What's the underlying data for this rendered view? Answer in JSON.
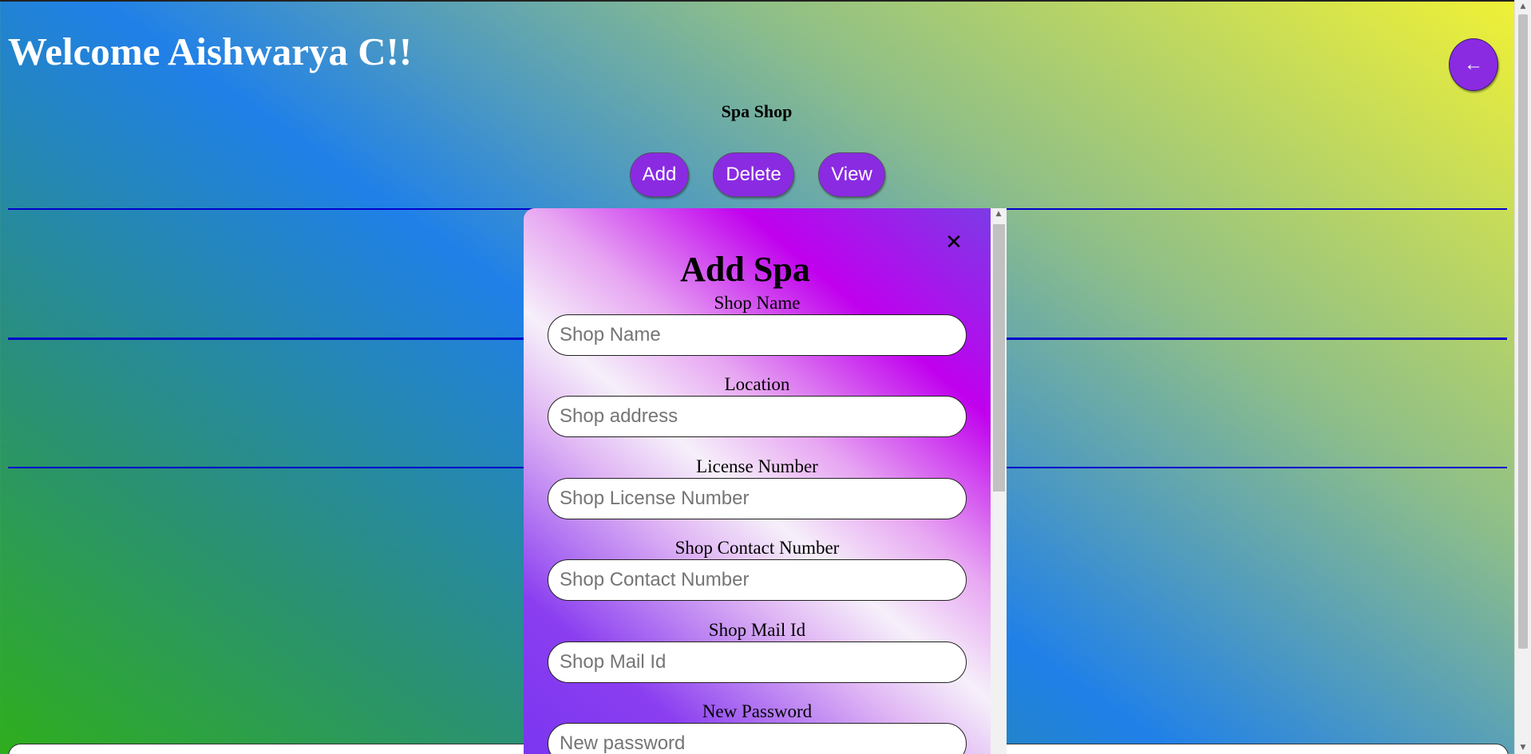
{
  "header": {
    "welcome": "Welcome Aishwarya C!!",
    "back_icon": "arrow-left-icon",
    "back_glyph": "←"
  },
  "page": {
    "subtitle": "Spa Shop"
  },
  "actions": {
    "add": "Add",
    "delete": "Delete",
    "view": "View"
  },
  "modal": {
    "title": "Add Spa",
    "close_icon": "close-icon",
    "close_glyph": "✕",
    "fields": [
      {
        "label": "Shop Name",
        "placeholder": "Shop Name"
      },
      {
        "label": "Location",
        "placeholder": "Shop address"
      },
      {
        "label": "License Number",
        "placeholder": "Shop License Number"
      },
      {
        "label": "Shop Contact Number",
        "placeholder": "Shop Contact Number"
      },
      {
        "label": "Shop Mail Id",
        "placeholder": "Shop Mail Id"
      },
      {
        "label": "New Password",
        "placeholder": "New password"
      }
    ]
  },
  "colors": {
    "button": "#8a2be2",
    "divider": "#0000cc"
  }
}
